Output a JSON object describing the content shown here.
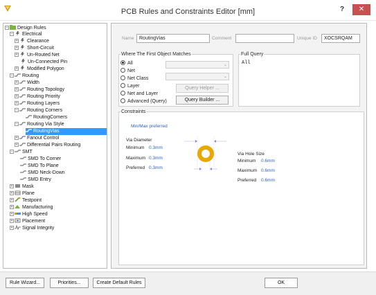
{
  "window": {
    "title": "PCB Rules and Constraints Editor [mm]",
    "help_label": "?",
    "close_label": "✕"
  },
  "tree": {
    "items": [
      {
        "label": "Design Rules"
      },
      {
        "label": "Electrical"
      },
      {
        "label": "Clearance"
      },
      {
        "label": "Short-Circuit"
      },
      {
        "label": "Un-Routed Net"
      },
      {
        "label": "Un-Connected Pin"
      },
      {
        "label": "Modified Polygon"
      },
      {
        "label": "Routing"
      },
      {
        "label": "Width"
      },
      {
        "label": "Routing Topology"
      },
      {
        "label": "Routing Priority"
      },
      {
        "label": "Routing Layers"
      },
      {
        "label": "Routing Corners"
      },
      {
        "label": "RoutingCorners"
      },
      {
        "label": "Routing Via Style"
      },
      {
        "label": "RoutingVias"
      },
      {
        "label": "Fanout Control"
      },
      {
        "label": "Differential Pairs Routing"
      },
      {
        "label": "SMT"
      },
      {
        "label": "SMD To Corner"
      },
      {
        "label": "SMD To Plane"
      },
      {
        "label": "SMD Neck-Down"
      },
      {
        "label": "SMD Entry"
      },
      {
        "label": "Mask"
      },
      {
        "label": "Plane"
      },
      {
        "label": "Testpoint"
      },
      {
        "label": "Manufacturing"
      },
      {
        "label": "High Speed"
      },
      {
        "label": "Placement"
      },
      {
        "label": "Signal Integrity"
      }
    ]
  },
  "rule": {
    "name_label": "Name",
    "name_value": "RoutingVias",
    "comment_label": "Comment",
    "comment_value": "",
    "unique_id_label": "Unique ID",
    "unique_id_value": "XOCSRQAM"
  },
  "first_object": {
    "title": "Where The First Object Matches",
    "options": [
      "All",
      "Net",
      "Net Class",
      "Layer",
      "Net and Layer",
      "Advanced (Query)"
    ],
    "selected": "All",
    "query_helper_label": "Query Helper ...",
    "query_builder_label": "Query Builder ..."
  },
  "full_query": {
    "title": "Full Query",
    "text": "All"
  },
  "constraints": {
    "title": "Constraints",
    "mode_label": "Min/Max preferred",
    "via_diameter": {
      "title": "Via Diameter",
      "minimum_label": "Minimum",
      "minimum_value": "0.3mm",
      "maximum_label": "Maximum",
      "maximum_value": "0.3mm",
      "preferred_label": "Preferred",
      "preferred_value": "0.3mm"
    },
    "via_hole_size": {
      "title": "Via Hole Size",
      "minimum_label": "Minimum",
      "minimum_value": "0.6mm",
      "maximum_label": "Maximum",
      "maximum_value": "0.6mm",
      "preferred_label": "Preferred",
      "preferred_value": "0.6mm"
    }
  },
  "buttons": {
    "rule_wizard": "Rule Wizard...",
    "priorities": "Priorities...",
    "create_default_rules": "Create Default Rules",
    "ok": "OK"
  },
  "colors": {
    "selection": "#3399ff",
    "value_blue": "#2a62c9",
    "via_ring": "#e8a800",
    "close_red": "#c75050"
  }
}
